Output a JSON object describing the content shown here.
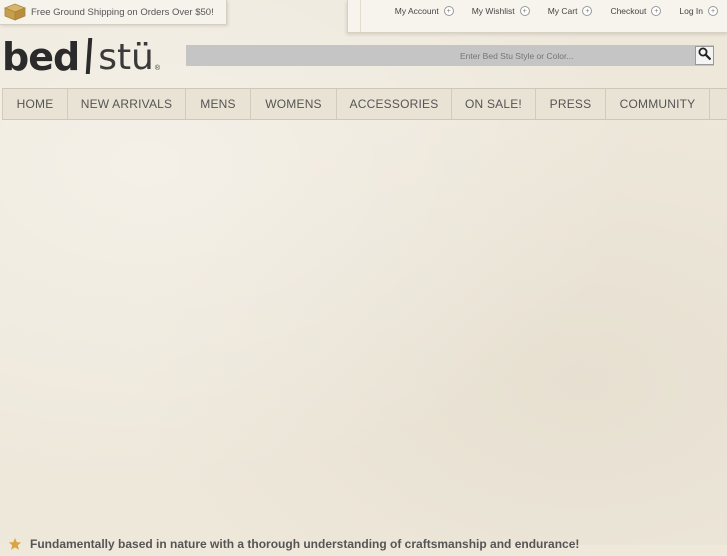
{
  "shipping_banner": {
    "text": "Free Ground Shipping on Orders Over $50!",
    "icon": "truck-icon"
  },
  "account_links": [
    {
      "label": "My Account"
    },
    {
      "label": "My Wishlist"
    },
    {
      "label": "My Cart"
    },
    {
      "label": "Checkout"
    },
    {
      "label": "Log In"
    }
  ],
  "logo": {
    "part1": "bed",
    "part2": "stü",
    "reg": "®"
  },
  "search": {
    "placeholder": "Enter Bed Stu Style or Color...",
    "icon": "search-icon"
  },
  "nav": [
    {
      "label": "HOME"
    },
    {
      "label": "NEW ARRIVALS"
    },
    {
      "label": "MENS"
    },
    {
      "label": "WOMENS"
    },
    {
      "label": "ACCESSORIES"
    },
    {
      "label": "ON SALE!"
    },
    {
      "label": "PRESS"
    },
    {
      "label": "COMMUNITY"
    }
  ],
  "tagline": {
    "text": "Fundamentally based in nature with a thorough understanding of craftsmanship and endurance!"
  },
  "colors": {
    "background": "#eee8db",
    "nav_bg": "#e9e3d5",
    "search_bar": "#c5c5c5",
    "accent": "#d9a441"
  }
}
